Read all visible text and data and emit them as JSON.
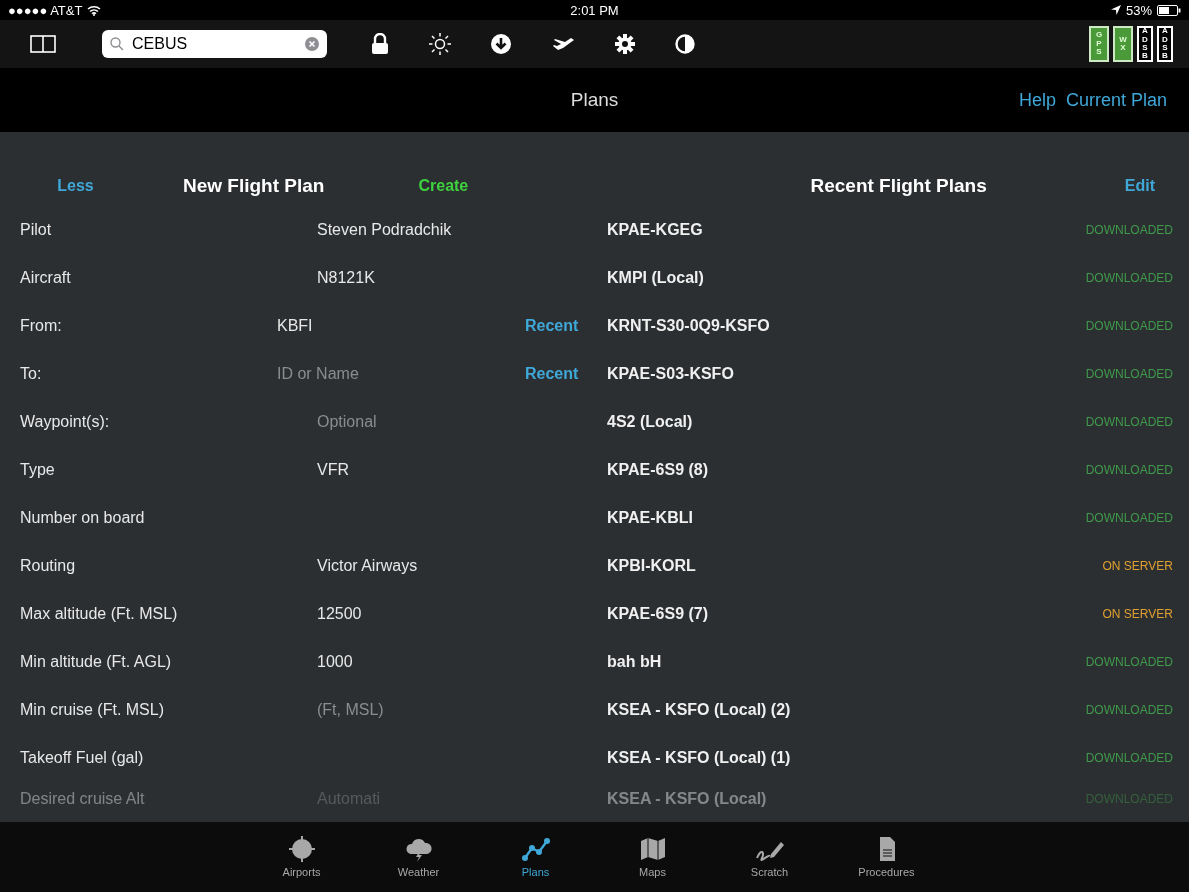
{
  "status_bar": {
    "carrier": "●●●●● AT&T",
    "time": "2:01 PM",
    "battery": "53%"
  },
  "toolbar": {
    "search": {
      "value": "CEBUS"
    },
    "badges": [
      {
        "label": "GPS",
        "on": true
      },
      {
        "label": "WX",
        "on": true
      },
      {
        "label": "ADSB",
        "on": false
      },
      {
        "label": "ADSB",
        "on": false
      }
    ]
  },
  "title_bar": {
    "title": "Plans",
    "links": [
      "Help",
      "Current Plan"
    ]
  },
  "new_plan": {
    "less": "Less",
    "title": "New Flight Plan",
    "create": "Create",
    "rows": [
      {
        "kind": "value",
        "label": "Pilot",
        "value": "Steven Podradchik"
      },
      {
        "kind": "value",
        "label": "Aircraft",
        "value": "N8121K"
      },
      {
        "kind": "lookup",
        "label": "From:",
        "value": "KBFI",
        "recent": "Recent"
      },
      {
        "kind": "lookup",
        "label": "To:",
        "placeholder": "ID or Name",
        "recent": "Recent"
      },
      {
        "kind": "value",
        "label": "Waypoint(s):",
        "placeholder": "Optional"
      },
      {
        "kind": "value",
        "label": "Type",
        "value": "VFR"
      },
      {
        "kind": "value",
        "label": "Number on board"
      },
      {
        "kind": "value",
        "label": "Routing",
        "value": "Victor Airways"
      },
      {
        "kind": "value",
        "label": "Max altitude (Ft. MSL)",
        "value": "12500"
      },
      {
        "kind": "value",
        "label": "Min altitude (Ft. AGL)",
        "value": "1000"
      },
      {
        "kind": "value",
        "label": "Min cruise (Ft. MSL)",
        "placeholder": "(Ft, MSL)"
      },
      {
        "kind": "value",
        "label": "Takeoff Fuel (gal)"
      },
      {
        "kind": "value",
        "label": "Desired cruise Alt",
        "placeholder": "Automati"
      }
    ]
  },
  "recent_plans": {
    "title": "Recent Flight Plans",
    "edit": "Edit",
    "plans": [
      {
        "name": "KPAE-KGEG",
        "status": "DOWNLOADED",
        "kind": "downloaded"
      },
      {
        "name": "KMPI (Local)",
        "status": "DOWNLOADED",
        "kind": "downloaded"
      },
      {
        "name": "KRNT-S30-0Q9-KSFO",
        "status": "DOWNLOADED",
        "kind": "downloaded"
      },
      {
        "name": "KPAE-S03-KSFO",
        "status": "DOWNLOADED",
        "kind": "downloaded"
      },
      {
        "name": "4S2 (Local)",
        "status": "DOWNLOADED",
        "kind": "downloaded"
      },
      {
        "name": "KPAE-6S9 (8)",
        "status": "DOWNLOADED",
        "kind": "downloaded"
      },
      {
        "name": "KPAE-KBLI",
        "status": "DOWNLOADED",
        "kind": "downloaded"
      },
      {
        "name": "KPBI-KORL",
        "status": "ON SERVER",
        "kind": "server"
      },
      {
        "name": "KPAE-6S9 (7)",
        "status": "ON SERVER",
        "kind": "server"
      },
      {
        "name": "bah bH",
        "status": "DOWNLOADED",
        "kind": "downloaded"
      },
      {
        "name": "KSEA - KSFO (Local) (2)",
        "status": "DOWNLOADED",
        "kind": "downloaded"
      },
      {
        "name": "KSEA - KSFO (Local) (1)",
        "status": "DOWNLOADED",
        "kind": "downloaded"
      },
      {
        "name": "KSEA - KSFO (Local)",
        "status": "DOWNLOADED",
        "kind": "downloaded"
      }
    ]
  },
  "tab_bar": [
    {
      "label": "Airports",
      "kind": "airports",
      "selected": false
    },
    {
      "label": "Weather",
      "kind": "weather",
      "selected": false
    },
    {
      "label": "Plans",
      "kind": "plans",
      "selected": true
    },
    {
      "label": "Maps",
      "kind": "maps",
      "selected": false
    },
    {
      "label": "Scratch",
      "kind": "scratch",
      "selected": false
    },
    {
      "label": "Procedures",
      "kind": "procedures",
      "selected": false
    }
  ]
}
